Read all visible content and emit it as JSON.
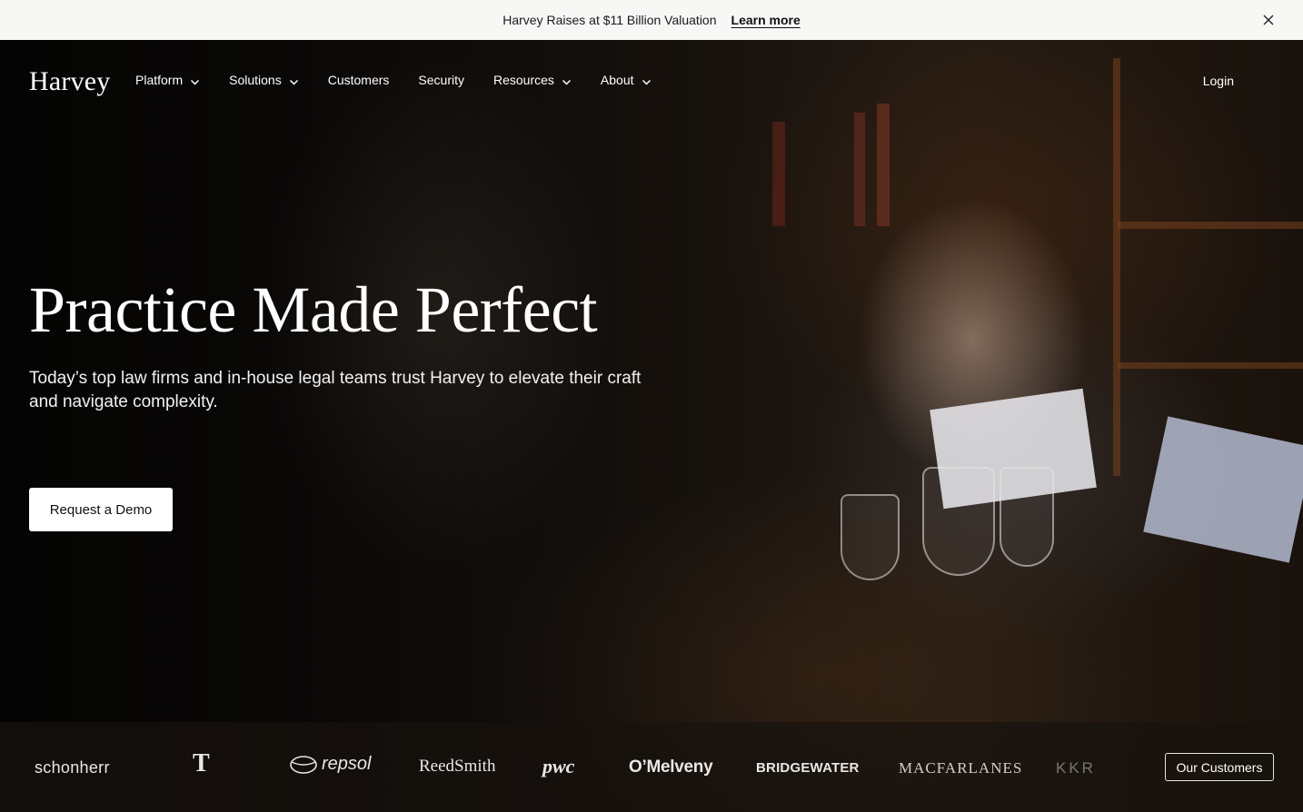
{
  "announcement": {
    "message": "Harvey Raises at $11 Billion Valuation",
    "link_label": "Learn more"
  },
  "nav": {
    "logo": "Harvey",
    "items": [
      {
        "label": "Platform",
        "has_dropdown": true
      },
      {
        "label": "Solutions",
        "has_dropdown": true
      },
      {
        "label": "Customers",
        "has_dropdown": false
      },
      {
        "label": "Security",
        "has_dropdown": false
      },
      {
        "label": "Resources",
        "has_dropdown": true
      },
      {
        "label": "About",
        "has_dropdown": true
      }
    ],
    "login_label": "Login"
  },
  "hero": {
    "headline": "Practice Made Perfect",
    "subheadline": "Today’s top law firms and in-house legal teams trust Harvey to elevate their craft and navigate complexity.",
    "cta_label": "Request a Demo"
  },
  "logos": {
    "brands": [
      "schonherr",
      "T",
      "repsol",
      "ReedSmith",
      "pwc",
      "O’Melveny",
      "BRIDGEWATER",
      "MACFARLANES",
      "KKR"
    ],
    "cta_label": "Our Customers"
  },
  "colors": {
    "announcement_bg": "#f7f7f5",
    "cta_bg": "#ffffff",
    "hero_text": "#ffffff"
  }
}
